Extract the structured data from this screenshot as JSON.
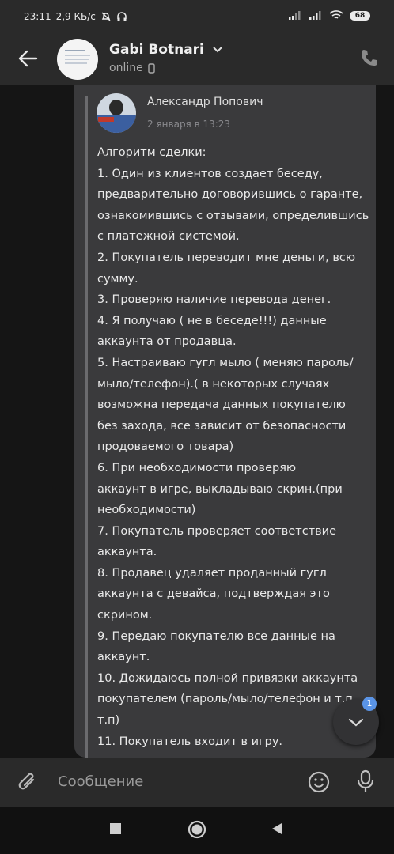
{
  "status_bar": {
    "time": "23:11",
    "speed": "2,9 КБ/с",
    "battery": "68"
  },
  "header": {
    "title": "Gabi Botnari",
    "status": "online"
  },
  "forwarded": {
    "author": "Александр Попович",
    "date": "2 января в 13:23",
    "lines": [
      "Алгоритм сделки:",
      "1. Один из клиентов создает беседу,",
      "предварительно договорившись о гаранте,",
      "ознакомившись с отзывами, определившись",
      "с платежной системой.",
      "2. Покупатель переводит мне деньги, всю",
      "сумму.",
      "3. Проверяю наличие перевода денег.",
      "4. Я получаю ( не в беседе!!!) данные",
      "аккаунта от продавца.",
      "5. Настраиваю гугл мыло ( меняю пароль/",
      "мыло/телефон).( в некоторых случаях",
      "возможна передача данных покупателю",
      "без захода, все зависит от безопасности",
      "продоваемого товара)",
      "6. При необходимости проверяю",
      "аккаунт в игре, выкладываю скрин.(при",
      "необходимости)",
      "7. Покупатель проверяет соответствие",
      "аккаунта.",
      "8. Продавец удаляет проданный гугл",
      "аккаунта с девайса, подтверждая это",
      "скрином.",
      "9. Передаю покупателю все данные на",
      "аккаунт.",
      "10. Дожидаюсь полной привязки аккаунта",
      "покупателем (пароль/мыло/телефон и т.п",
      "т.п)",
      "11. Покупатель входит в игру."
    ]
  },
  "scroll_badge": "1",
  "input": {
    "placeholder": "Сообщение"
  },
  "icons": [
    "back-arrow-icon",
    "phone-icon",
    "paperclip-icon",
    "emoji-icon",
    "microphone-icon",
    "chevron-down-icon",
    "nav-square-icon",
    "nav-circle-icon",
    "nav-triangle-icon"
  ]
}
